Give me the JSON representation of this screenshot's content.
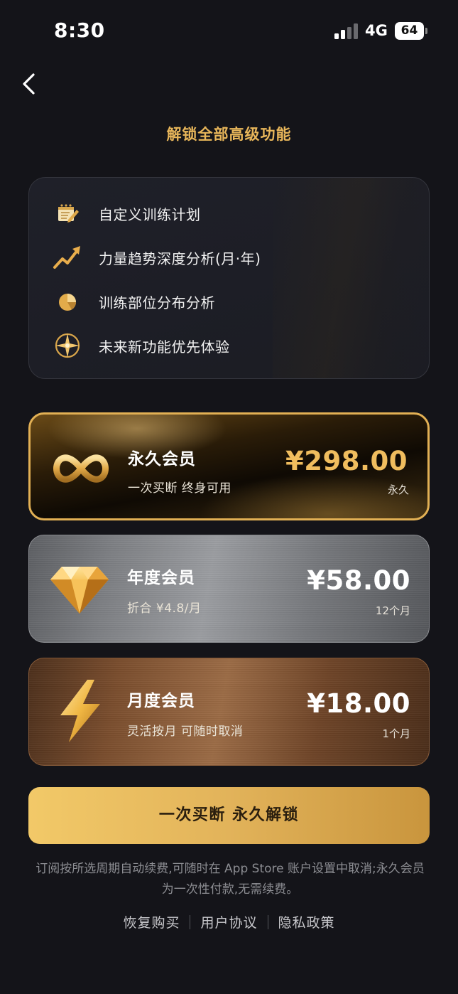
{
  "status_bar": {
    "time": "8:30",
    "network": "4G",
    "battery": "64"
  },
  "nav": {
    "back_icon": "chevron-left-icon"
  },
  "page": {
    "title": "解锁全部高级功能"
  },
  "features": [
    {
      "icon": "notepad-edit-icon",
      "label": "自定义训练计划"
    },
    {
      "icon": "trend-up-arrow-icon",
      "label": "力量趋势深度分析(月·年)"
    },
    {
      "icon": "pie-chart-icon",
      "label": "训练部位分布分析"
    },
    {
      "icon": "compass-star-icon",
      "label": "未来新功能优先体验"
    }
  ],
  "plans": {
    "lifetime": {
      "icon": "infinity-icon",
      "name": "永久会员",
      "desc": "一次买断 终身可用",
      "price": "¥298.00",
      "period": "永久",
      "selected": true
    },
    "annual": {
      "icon": "diamond-icon",
      "name": "年度会员",
      "desc": "折合 ¥4.8/月",
      "price": "¥58.00",
      "period": "12个月"
    },
    "monthly": {
      "icon": "lightning-icon",
      "name": "月度会员",
      "desc": "灵活按月 可随时取消",
      "price": "¥18.00",
      "period": "1个月"
    }
  },
  "purchase": {
    "button_label": "一次买断 永久解锁"
  },
  "notice": "订阅按所选周期自动续费,可随时在 App Store 账户设置中取消;永久会员为一次性付款,无需续费。",
  "footer": {
    "restore": "恢复购买",
    "terms": "用户协议",
    "privacy": "隐私政策"
  },
  "colors": {
    "background": "#141419",
    "accent_gold": "#e8b65a",
    "button_gold": "#e2b35a"
  }
}
